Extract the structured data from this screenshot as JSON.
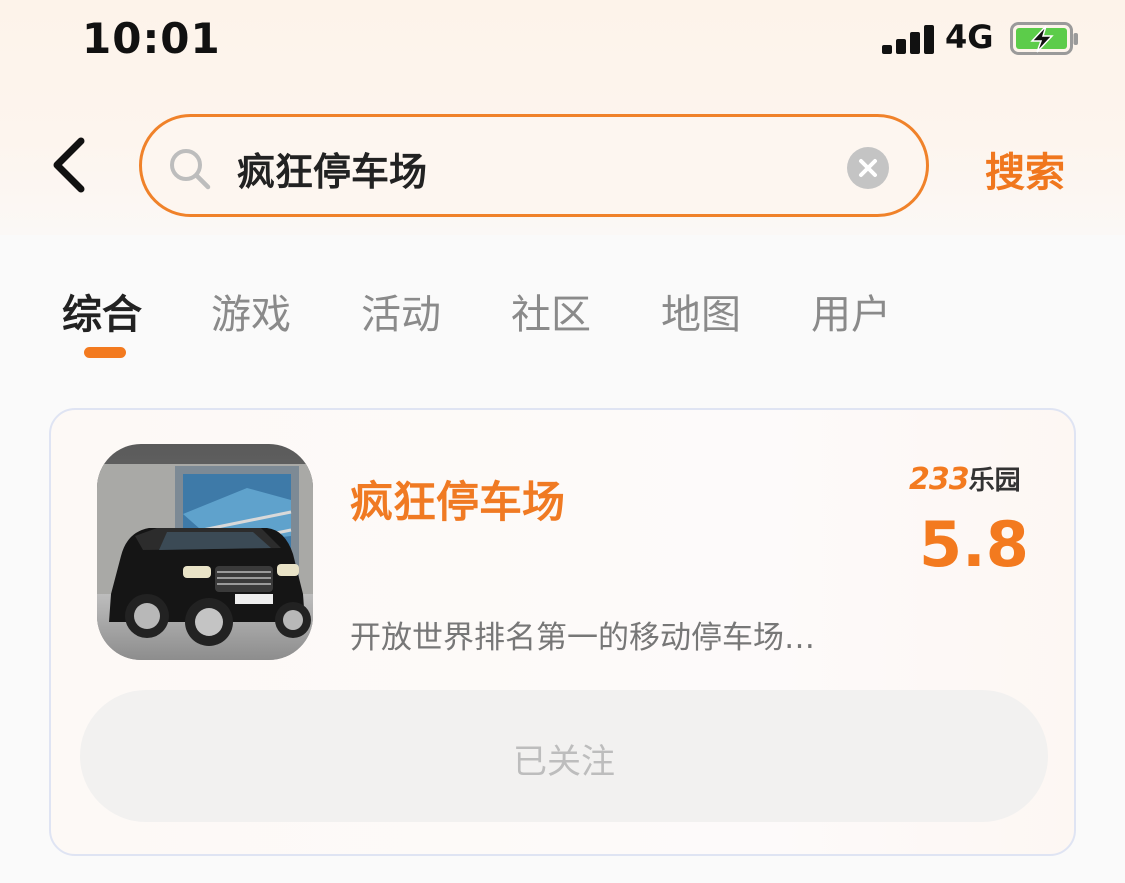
{
  "status_bar": {
    "time": "10:01",
    "network": "4G",
    "battery_icon": "battery-charging-icon"
  },
  "header": {
    "search_query": "疯狂停车场",
    "search_button_label": "搜索",
    "accent_color": "#f0822a"
  },
  "tabs": [
    {
      "label": "综合",
      "active": true
    },
    {
      "label": "游戏",
      "active": false
    },
    {
      "label": "活动",
      "active": false
    },
    {
      "label": "社区",
      "active": false
    },
    {
      "label": "地图",
      "active": false
    },
    {
      "label": "用户",
      "active": false
    }
  ],
  "result_card": {
    "app_name": "疯狂停车场",
    "description": "开放世界排名第一的移动停车场…",
    "brand_number": "233",
    "brand_text": "乐园",
    "score": "5.8",
    "follow_label": "已关注",
    "score_color": "#f37a1f"
  }
}
